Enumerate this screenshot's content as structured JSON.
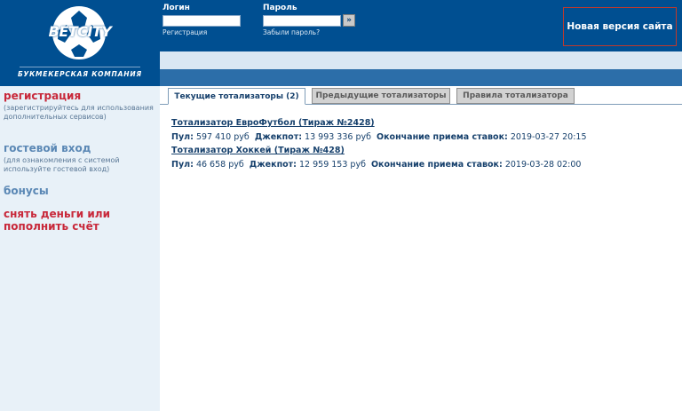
{
  "header": {
    "logo_text": "BETCITY",
    "logo_subtitle": "БУКМЕКЕРСКАЯ КОМПАНИЯ",
    "login_label": "Логин",
    "password_label": "Пароль",
    "register_link": "Регистрация",
    "forgot_link": "Забыли пароль?",
    "go_button": "»",
    "new_version": "Новая версия сайта"
  },
  "sidebar": {
    "registration": {
      "title": "регистрация",
      "note": "(зарегистрируйтесь для использования дополнительных сервисов)"
    },
    "guest": {
      "title": "гостевой вход",
      "note": "(для ознакомления с системой используйте гостевой вход)"
    },
    "bonuses": "бонусы",
    "withdraw": "снять деньги или пополнить счёт"
  },
  "tabs": [
    {
      "label": "Текущие тотализаторы (2)",
      "active": true
    },
    {
      "label": "Предыдущие тотализаторы",
      "active": false
    },
    {
      "label": "Правила тотализатора",
      "active": false
    }
  ],
  "totalizators": [
    {
      "title": "Тотализатор ЕвроФутбол (Тираж №2428)",
      "pool_label": "Пул:",
      "pool_value": "597 410 руб",
      "jackpot_label": "Джекпот:",
      "jackpot_value": "13 993 336 руб",
      "end_label": "Окончание приема ставок:",
      "end_value": "2019-03-27 20:15"
    },
    {
      "title": "Тотализатор Хоккей (Тираж №428)",
      "pool_label": "Пул:",
      "pool_value": "46 658 руб",
      "jackpot_label": "Джекпот:",
      "jackpot_value": "12 959 153 руб",
      "end_label": "Окончание приема ставок:",
      "end_value": "2019-03-28 02:00"
    }
  ],
  "colors": {
    "header_blue": "#004f91",
    "sidebar_bg": "#e8f1f8",
    "sidebar_red": "#c8283a",
    "sidebar_blue": "#5b88b5",
    "text_navy": "#16406c"
  }
}
